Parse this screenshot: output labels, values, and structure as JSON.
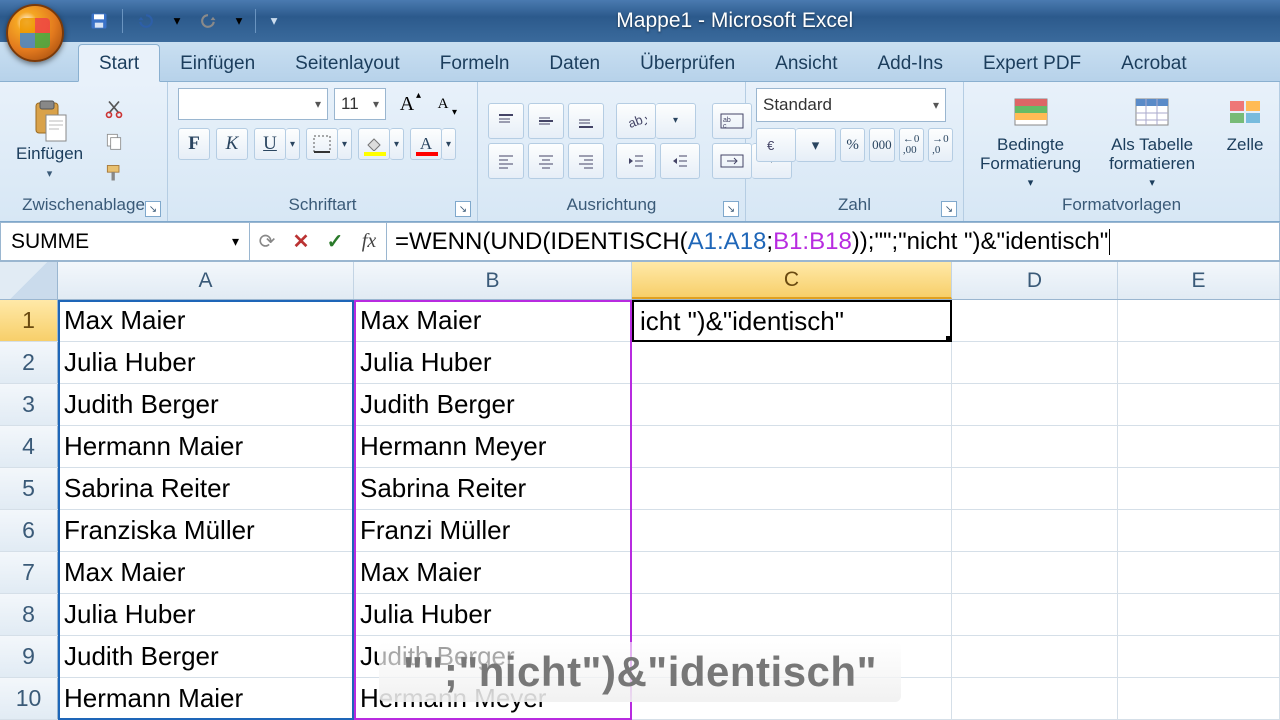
{
  "window": {
    "title": "Mappe1 - Microsoft Excel"
  },
  "tabs": [
    "Start",
    "Einfügen",
    "Seitenlayout",
    "Formeln",
    "Daten",
    "Überprüfen",
    "Ansicht",
    "Add-Ins",
    "Expert PDF",
    "Acrobat"
  ],
  "active_tab": 0,
  "ribbon": {
    "clipboard": {
      "label": "Zwischenablage",
      "paste": "Einfügen"
    },
    "font": {
      "label": "Schriftart",
      "name": "",
      "size": "11"
    },
    "align": {
      "label": "Ausrichtung"
    },
    "number": {
      "label": "Zahl",
      "format": "Standard"
    },
    "styles": {
      "label": "Formatvorlagen",
      "cond": "Bedingte\nFormatierung",
      "table": "Als Tabelle\nformatieren",
      "cell": "Zelle"
    }
  },
  "formula_bar": {
    "name_box": "SUMME",
    "formula_prefix": "=WENN(UND(IDENTISCH(",
    "ref1": "A1:A18",
    "sep1": ";",
    "ref2": "B1:B18",
    "suffix": "));\"\";\"nicht \")&\"identisch\""
  },
  "columns": [
    "A",
    "B",
    "C",
    "D",
    "E"
  ],
  "active_col": "C",
  "grid": {
    "rows": [
      {
        "n": 1,
        "A": "Max Maier",
        "B": "Max Maier",
        "C": "icht \")&\"identisch\""
      },
      {
        "n": 2,
        "A": "Julia Huber",
        "B": "Julia Huber",
        "C": ""
      },
      {
        "n": 3,
        "A": "Judith Berger",
        "B": "Judith Berger",
        "C": ""
      },
      {
        "n": 4,
        "A": "Hermann Maier",
        "B": "Hermann Meyer",
        "C": ""
      },
      {
        "n": 5,
        "A": "Sabrina Reiter",
        "B": "Sabrina Reiter",
        "C": ""
      },
      {
        "n": 6,
        "A": "Franziska Müller",
        "B": "Franzi Müller",
        "C": ""
      },
      {
        "n": 7,
        "A": "Max Maier",
        "B": "Max Maier",
        "C": ""
      },
      {
        "n": 8,
        "A": "Julia Huber",
        "B": "Julia Huber",
        "C": ""
      },
      {
        "n": 9,
        "A": "Judith Berger",
        "B": "Judith Berger",
        "C": ""
      },
      {
        "n": 10,
        "A": "Hermann Maier",
        "B": "Hermann Meyer",
        "C": ""
      }
    ],
    "active_row": 1
  },
  "overlay": "\"\";\"nicht\")&\"identisch\"",
  "icons": {
    "save": "save",
    "undo": "undo",
    "redo": "redo",
    "cut": "cut",
    "copy": "copy",
    "brush": "brush",
    "grow": "A▲",
    "shrink": "A▼"
  }
}
